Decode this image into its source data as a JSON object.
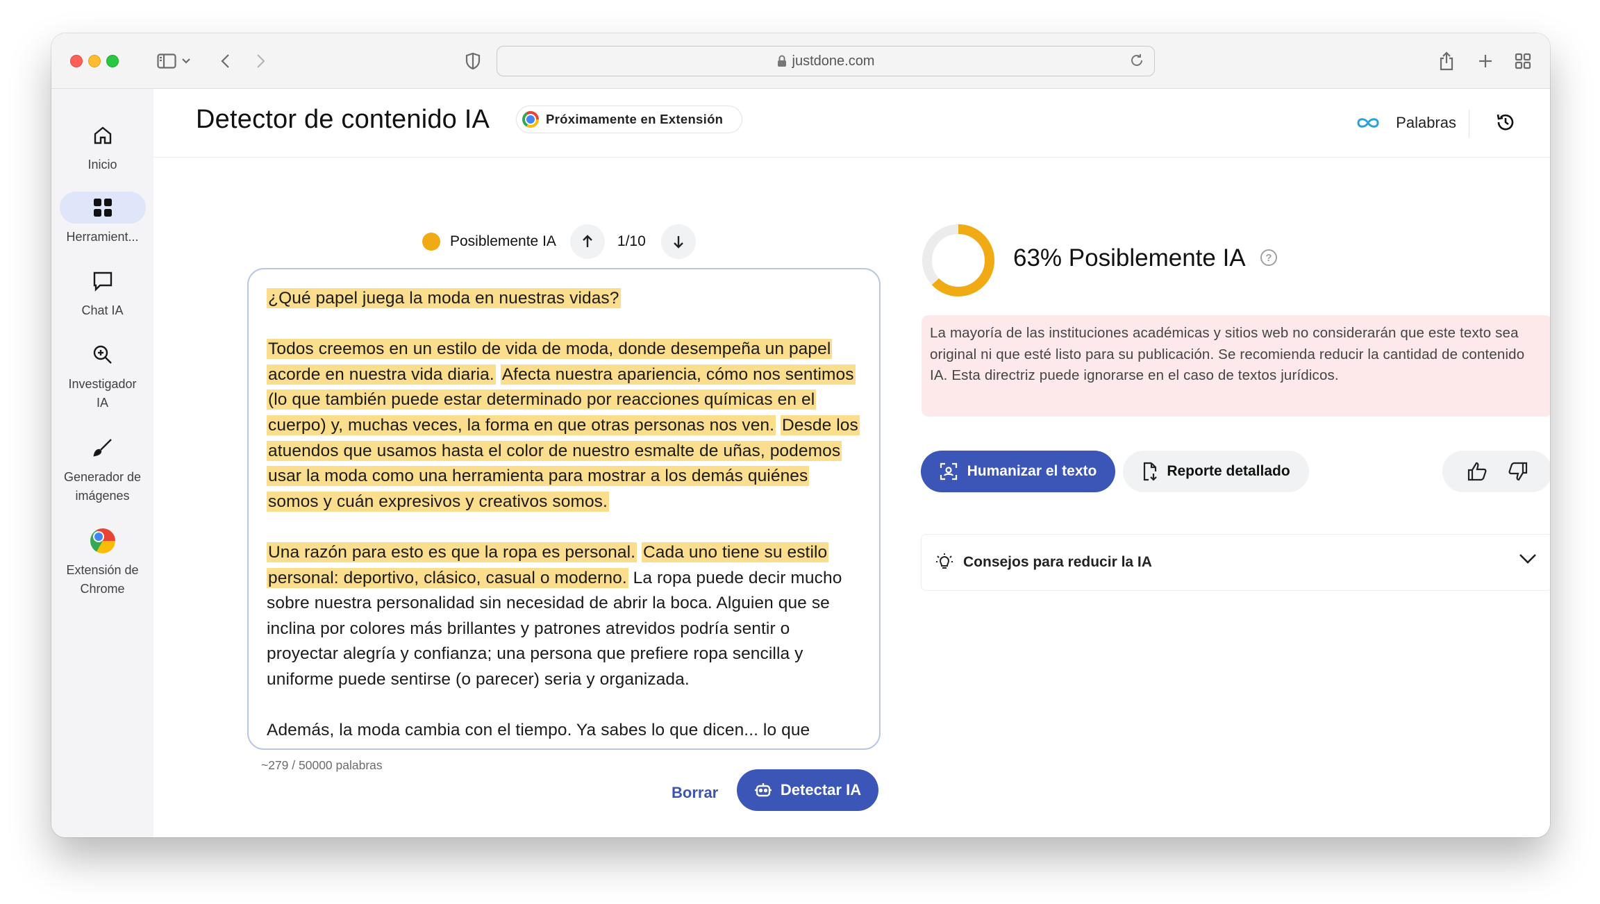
{
  "browser": {
    "url": "justdone.com"
  },
  "sidebar": {
    "items": [
      {
        "label": "Inicio",
        "icon": "home-icon"
      },
      {
        "label": "Herramient...",
        "icon": "grid-icon",
        "active": true
      },
      {
        "label": "Chat IA",
        "icon": "chat-icon"
      },
      {
        "label": "Investigador IA",
        "icon": "search-zoom-icon"
      },
      {
        "label": "Generador de imágenes",
        "icon": "brush-icon"
      },
      {
        "label": "Extensión de Chrome",
        "icon": "chrome-icon"
      }
    ]
  },
  "header": {
    "title": "Detector de contenido IA",
    "extension_badge": "Próximamente en Extensión",
    "words_label": "Palabras"
  },
  "navigator": {
    "label": "Posiblemente IA",
    "position": "1/10",
    "dot_color": "#f0aa13"
  },
  "editor": {
    "paragraphs": [
      [
        {
          "text": "¿Qué papel juega la moda en nuestras vidas?",
          "ai": true
        }
      ],
      [
        {
          "text": "Todos creemos en un estilo de vida de moda, donde desempeña un papel acorde en nuestra vida diaria.",
          "ai": true
        },
        {
          "text": " ",
          "ai": false
        },
        {
          "text": "Afecta nuestra apariencia, cómo nos sentimos (lo que también puede estar determinado por reacciones químicas en el cuerpo) y, muchas veces, la forma en que otras personas nos ven.",
          "ai": true
        },
        {
          "text": " ",
          "ai": false
        },
        {
          "text": "Desde los atuendos que usamos hasta el color de nuestro esmalte de uñas, podemos usar la moda como una herramienta para mostrar a los demás quiénes somos y cuán expresivos y creativos somos.",
          "ai": true
        }
      ],
      [
        {
          "text": "Una razón para esto es que la ropa es personal.",
          "ai": true
        },
        {
          "text": " ",
          "ai": false
        },
        {
          "text": "Cada uno tiene su estilo personal: deportivo, clásico, casual o moderno.",
          "ai": true
        },
        {
          "text": " La ropa puede decir mucho sobre nuestra personalidad sin necesidad de abrir la boca. Alguien que se inclina por colores más brillantes y patrones atrevidos podría sentir o proyectar alegría y confianza; una persona que prefiere ropa sencilla y uniforme puede sentirse (o parecer) seria y organizada.",
          "ai": false
        }
      ],
      [
        {
          "text": "Además, la moda cambia con el tiempo. Ya sabes lo que dicen... lo que",
          "ai": false
        }
      ]
    ],
    "word_count": "~279 / 50000 palabras",
    "highlight_color": "#fbdd8e"
  },
  "actions": {
    "clear_label": "Borrar",
    "detect_label": "Detectar IA"
  },
  "result": {
    "percent": 63,
    "score_text": "63% Posiblemente IA",
    "ring_color": "#f0aa13",
    "warning": "La mayoría de las instituciones académicas y sitios web no considerarán que este texto sea original ni que esté listo para su publicación. Se recomienda reducir la cantidad de contenido IA. Esta directriz puede ignorarse en el caso de textos jurídicos.",
    "humanize_label": "Humanizar el texto",
    "report_label": "Reporte detallado",
    "tips_label": "Consejos para reducir la IA"
  },
  "colors": {
    "accent": "#3b56b6",
    "warning_bg": "#fde9e9"
  }
}
